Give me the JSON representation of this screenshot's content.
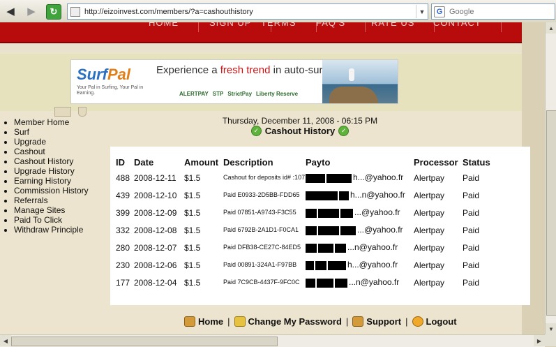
{
  "browser": {
    "url": "http://eizoinvest.com/members/?a=cashouthistory",
    "search_placeholder": "Google",
    "search_engine_icon": "G"
  },
  "nav_items": [
    "HOME",
    "SIGN UP",
    "TERMS",
    "FAQ'S",
    "RATE US",
    "CONTACT"
  ],
  "banner": {
    "logo_surf": "Surf",
    "logo_pal": "Pal",
    "tagline": "Your Pal in Surfing, Your Pal in Earning.",
    "headline_pre": "Experience a ",
    "headline_highlight": "fresh trend",
    "headline_post": " in auto-surfing.",
    "processors": [
      "ALERTPAY",
      "STP",
      "StrictPay",
      "Liberty Reserve"
    ]
  },
  "sidebar": {
    "items": [
      "Member Home",
      "Surf",
      "Upgrade",
      "Cashout",
      "Cashout History",
      "Upgrade History",
      "Earning History",
      "Commission History",
      "Referrals",
      "Manage Sites",
      "Paid To Click",
      "Withdraw Principle"
    ]
  },
  "main": {
    "datetime": "Thursday, December 11, 2008 - 06:15 PM",
    "title": "Cashout History"
  },
  "table": {
    "headers": [
      "ID",
      "Date",
      "Amount",
      "Description",
      "Payto",
      "Processor",
      "Status"
    ],
    "rows": [
      {
        "id": "488",
        "date": "2008-12-11",
        "amount": "$1.5",
        "description": "Cashout for deposits id# :107",
        "payto": "h...@yahoo.fr",
        "processor": "Alertpay",
        "status": "Paid"
      },
      {
        "id": "439",
        "date": "2008-12-10",
        "amount": "$1.5",
        "description": "Paid E0933-2D5BB-FDD65",
        "payto": "h...n@yahoo.fr",
        "processor": "Alertpay",
        "status": "Paid"
      },
      {
        "id": "399",
        "date": "2008-12-09",
        "amount": "$1.5",
        "description": "Paid 07851-A9743-F3C55",
        "payto": "...@yahoo.fr",
        "processor": "Alertpay",
        "status": "Paid"
      },
      {
        "id": "332",
        "date": "2008-12-08",
        "amount": "$1.5",
        "description": "Paid 6792B-2A1D1-F0CA1",
        "payto": "...@yahoo.fr",
        "processor": "Alertpay",
        "status": "Paid"
      },
      {
        "id": "280",
        "date": "2008-12-07",
        "amount": "$1.5",
        "description": "Paid DFB38-CE27C-84ED5",
        "payto": "...n@yahoo.fr",
        "processor": "Alertpay",
        "status": "Paid"
      },
      {
        "id": "230",
        "date": "2008-12-06",
        "amount": "$1.5",
        "description": "Paid 00891-324A1-F97BB",
        "payto": "h...@yahoo.fr",
        "processor": "Alertpay",
        "status": "Paid"
      },
      {
        "id": "177",
        "date": "2008-12-04",
        "amount": "$1.5",
        "description": "Paid 7C9CB-4437F-9FC0C",
        "payto": "...n@yahoo.fr",
        "processor": "Alertpay",
        "status": "Paid"
      }
    ]
  },
  "footer": {
    "home": "Home",
    "change_password": "Change My Password",
    "support": "Support",
    "logout": "Logout",
    "separator": "|"
  },
  "colors": {
    "nav_red": "#b80c0c",
    "content_bg": "#ece4ce",
    "highlight_red": "#d01010",
    "check_green": "#5fb33a"
  }
}
